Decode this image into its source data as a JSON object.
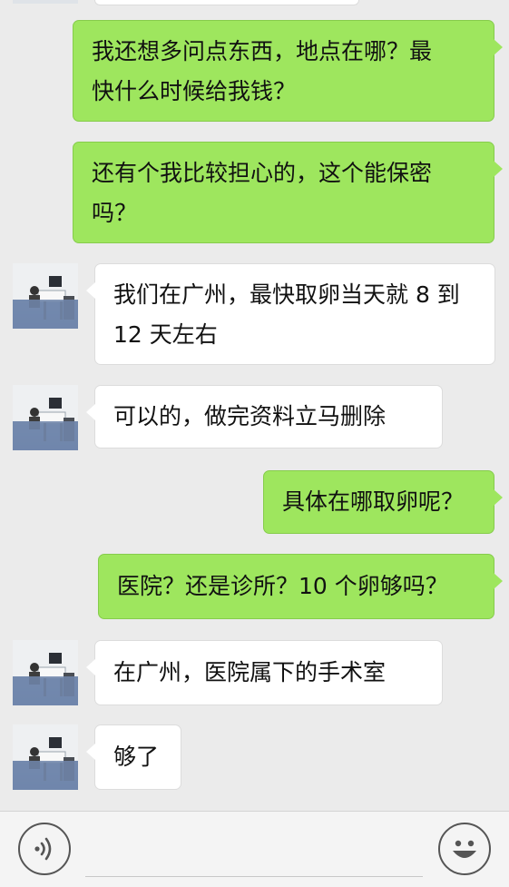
{
  "messages": [
    {
      "direction": "outgoing",
      "lines": [
        "我还想多问点东西，地点在哪？最",
        "快什么时候给我钱？"
      ]
    },
    {
      "direction": "outgoing",
      "lines": [
        "还有个我比较担心的，这个能保密",
        "吗？"
      ]
    },
    {
      "direction": "incoming",
      "lines": [
        "我们在广州，最快取卵当天就 8 到",
        "12 天左右"
      ]
    },
    {
      "direction": "incoming",
      "lines": [
        "可以的，做完资料立马删除"
      ]
    },
    {
      "direction": "outgoing",
      "lines": [
        "具体在哪取卵呢？"
      ]
    },
    {
      "direction": "outgoing",
      "lines": [
        "医院？还是诊所？10 个卵够吗？"
      ]
    },
    {
      "direction": "incoming",
      "lines": [
        "在广州，医院属下的手术室"
      ]
    },
    {
      "direction": "incoming",
      "lines": [
        "够了"
      ]
    }
  ],
  "input_bar": {
    "voice_icon": "voice-icon",
    "emoji_icon": "emoji-icon",
    "message_value": ""
  },
  "colors": {
    "outgoing_bubble": "#9ee65e",
    "incoming_bubble": "#ffffff",
    "background": "#ebebeb"
  }
}
